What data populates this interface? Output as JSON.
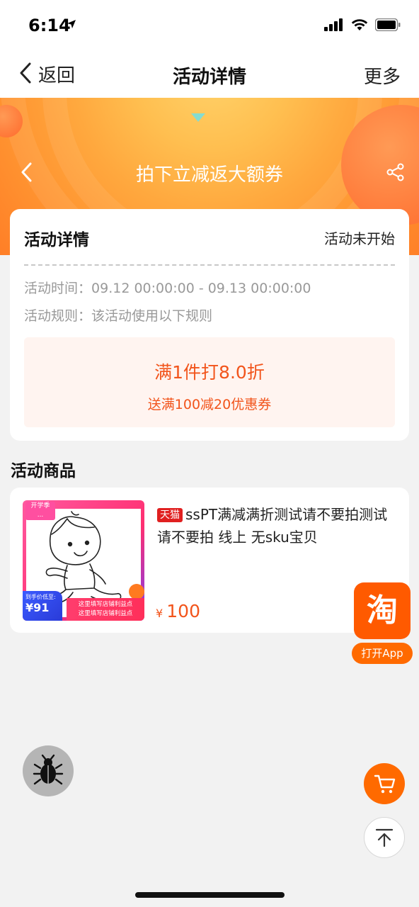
{
  "status_bar": {
    "time": "6:14"
  },
  "nav": {
    "back_label": "返回",
    "title": "活动详情",
    "more_label": "更多"
  },
  "banner": {
    "title": "拍下立减返大额券"
  },
  "detail": {
    "title": "活动详情",
    "status": "活动未开始",
    "time_label": "活动时间：",
    "time_value": "09.12 00:00:00 - 09.13 00:00:00",
    "rule_label": "活动规则：",
    "rule_value": "该活动使用以下规则",
    "offer_main": "满1件打8.0折",
    "offer_sub": "送满100减20优惠券"
  },
  "products": {
    "section_title": "活动商品",
    "items": [
      {
        "badge": "天猫",
        "name": "ssPT满减满折测试请不要拍测试请不要拍 线上 无sku宝贝",
        "currency": "¥",
        "price": "100",
        "thumb_tag_line1": "开学季",
        "thumb_tag_line2": "...",
        "thumb_price_label": "到手价低至:",
        "thumb_price": "¥91",
        "thumb_strip_line1": "这里填写店铺利益点",
        "thumb_strip_line2": "这里填写店铺利益点"
      }
    ]
  },
  "floating": {
    "taobao_glyph": "淘",
    "open_app_label": "打开App"
  },
  "colors": {
    "accent": "#ff6a00",
    "offer_text": "#f2541b",
    "offer_bg": "#fff4f0",
    "tmall_red": "#e02020"
  },
  "icons": {
    "back": "chevron-left-icon",
    "share": "share-icon",
    "location": "location-arrow-icon",
    "cart": "cart-icon",
    "top": "arrow-up-icon",
    "debug": "bug-icon"
  }
}
